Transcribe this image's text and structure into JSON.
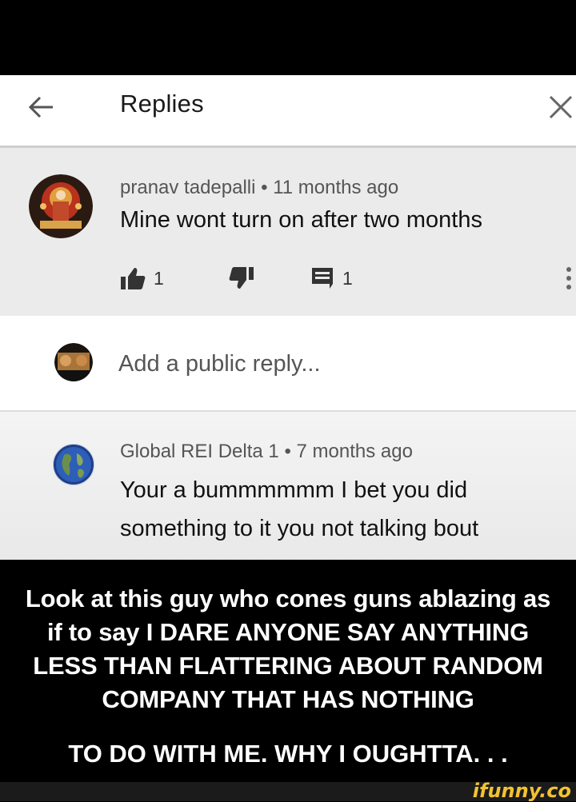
{
  "header": {
    "title": "Replies"
  },
  "comment": {
    "author": "pranav tadepalli",
    "separator": "•",
    "time": "11 months ago",
    "text": "Mine wont turn on after two months",
    "likes": "1",
    "replies": "1"
  },
  "reply_box": {
    "placeholder": "Add a public reply..."
  },
  "reply": {
    "author": "Global REI Delta 1",
    "separator": "•",
    "time": "7 months ago",
    "text_line1": "Your a bummmmmm I bet you did",
    "text_line2": "something  to it you not talking bout"
  },
  "caption": {
    "line1": "Look at this guy who cones guns ablazing as",
    "line2": "if to say I DARE ANYONE SAY ANYTHING",
    "line3": "LESS THAN FLATTERING ABOUT RANDOM",
    "line4": "COMPANY THAT HAS NOTHING",
    "line5": "TO DO WITH ME.  WHY I OUGHTTA. . ."
  },
  "watermark": "ifunny.co",
  "icons": [
    "back-arrow-icon",
    "close-icon",
    "thumbs-up-icon",
    "thumbs-down-icon",
    "reply-comment-icon",
    "more-vert-icon"
  ],
  "colors": {
    "background": "#000000",
    "comment_bg": "#ebebeb",
    "header_bg": "#ffffff",
    "watermark": "#f2c230"
  }
}
